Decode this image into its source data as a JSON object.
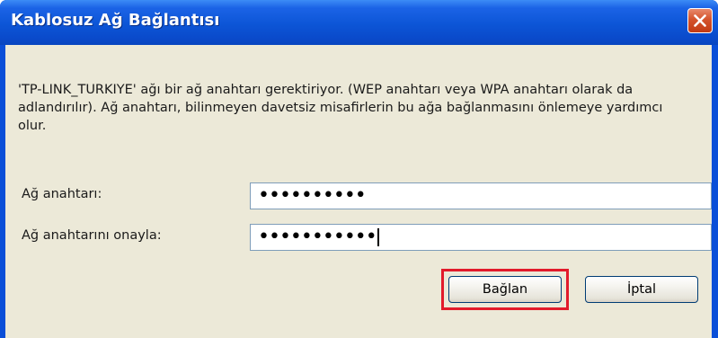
{
  "window": {
    "title": "Kablosuz Ağ Bağlantısı"
  },
  "dialog": {
    "message": "'TP-LINK_TURKIYE' ağı bir ağ anahtarı gerektiriyor. (WEP anahtarı veya WPA anahtarı olarak da adlandırılır). Ağ anahtarı, bilinmeyen davetsiz misafirlerin bu ağa bağlanmasını önlemeye yardımcı olur.",
    "key_label": "Ağ anahtarı:",
    "key_value": "••••••••••",
    "confirm_label": "Ağ anahtarını onayla:",
    "confirm_value": "•••••••••••",
    "connect_label": "Bağlan",
    "cancel_label": "İptal"
  },
  "colors": {
    "title_bar": "#0c55d6",
    "close_button": "#d4532c",
    "client_background": "#ece9d8",
    "highlight": "#e21b2b"
  },
  "icons": {
    "close": "close-icon"
  }
}
